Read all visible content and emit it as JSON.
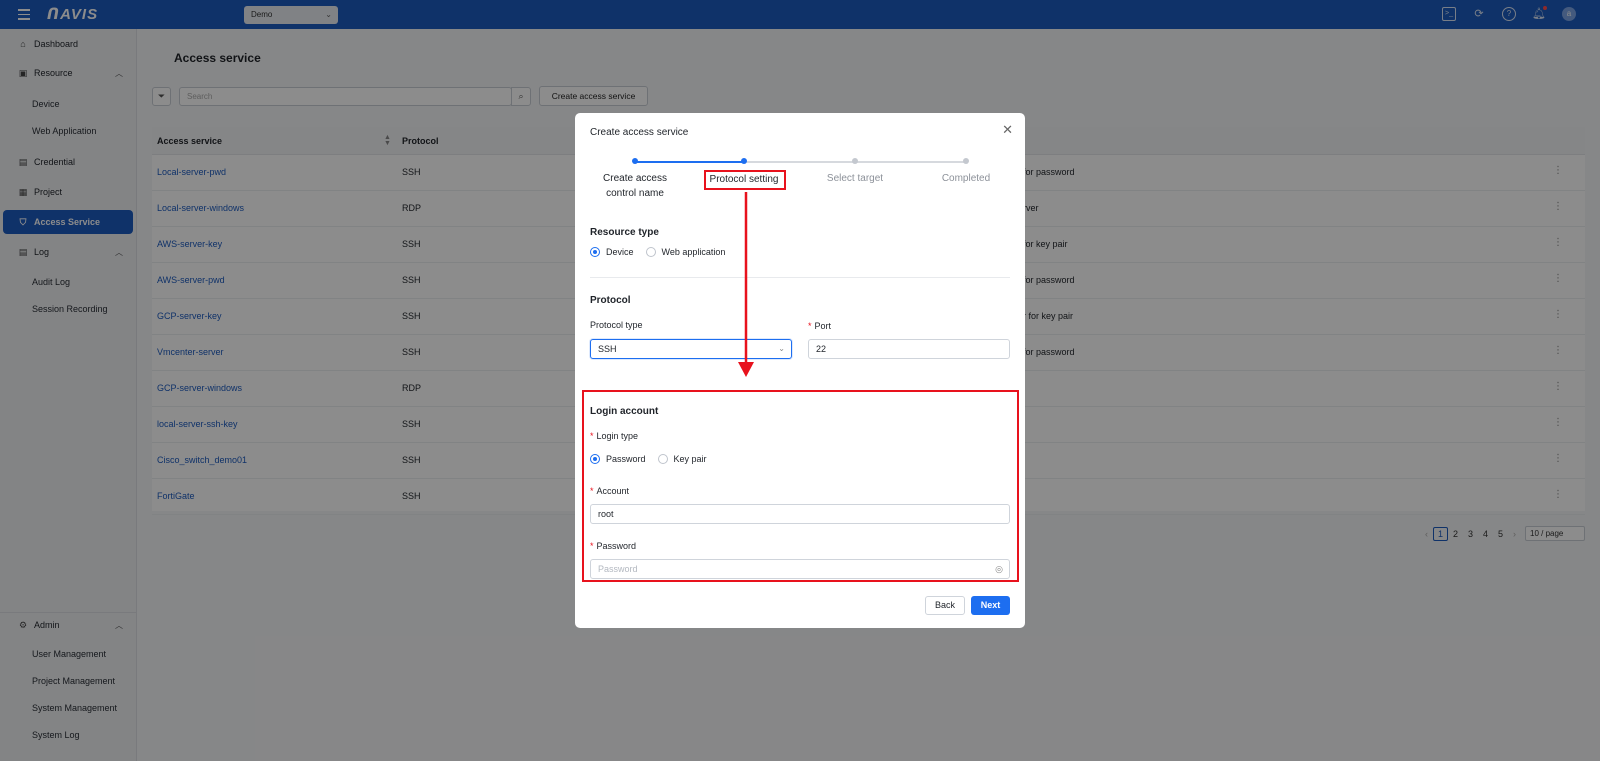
{
  "topbar": {
    "logo": "ᑎAVIS",
    "project": "Demo",
    "avatar_initial": "a"
  },
  "sidebar": {
    "dashboard": "Dashboard",
    "resource": "Resource",
    "device": "Device",
    "web_application": "Web Application",
    "credential": "Credential",
    "project": "Project",
    "access_service": "Access Service",
    "log": "Log",
    "audit_log": "Audit Log",
    "session_recording": "Session Recording",
    "admin": "Admin",
    "user_management": "User Management",
    "project_management": "Project Management",
    "system_management": "System Management",
    "system_log": "System Log"
  },
  "page": {
    "title": "Access service",
    "search_placeholder": "Search",
    "create_button": "Create access service"
  },
  "table": {
    "headers": {
      "name": "Access service",
      "protocol": "Protocol"
    },
    "rows": [
      {
        "name": "Local-server-pwd",
        "protocol": "SSH",
        "desc": "for password"
      },
      {
        "name": "Local-server-windows",
        "protocol": "RDP",
        "desc": "rver"
      },
      {
        "name": "AWS-server-key",
        "protocol": "SSH",
        "desc": "for key pair"
      },
      {
        "name": "AWS-server-pwd",
        "protocol": "SSH",
        "desc": "for password"
      },
      {
        "name": "GCP-server-key",
        "protocol": "SSH",
        "desc": "r for key pair"
      },
      {
        "name": "Vmcenter-server",
        "protocol": "SSH",
        "desc": "for password"
      },
      {
        "name": "GCP-server-windows",
        "protocol": "RDP",
        "desc": ""
      },
      {
        "name": "local-server-ssh-key",
        "protocol": "SSH",
        "desc": ""
      },
      {
        "name": "Cisco_switch_demo01",
        "protocol": "SSH",
        "desc": ""
      },
      {
        "name": "FortiGate",
        "protocol": "SSH",
        "desc": ""
      }
    ]
  },
  "pagination": {
    "pages": [
      "1",
      "2",
      "3",
      "4",
      "5"
    ],
    "current": "1",
    "page_size": "10 / page"
  },
  "modal": {
    "title": "Create access service",
    "steps": {
      "s1_line1": "Create access",
      "s1_line2": "control name",
      "s2": "Protocol setting",
      "s3": "Select target",
      "s4": "Completed"
    },
    "resource_type": {
      "title": "Resource type",
      "device": "Device",
      "web_application": "Web application",
      "selected": "Device"
    },
    "protocol": {
      "title": "Protocol",
      "type_label": "Protocol type",
      "type_value": "SSH",
      "port_label": "Port",
      "port_value": "22"
    },
    "login": {
      "title": "Login account",
      "type_label": "Login type",
      "password_option": "Password",
      "keypair_option": "Key pair",
      "selected": "Password",
      "account_label": "Account",
      "account_value": "root",
      "password_label": "Password",
      "password_placeholder": "Password"
    },
    "back_button": "Back",
    "next_button": "Next"
  },
  "colors": {
    "brand": "#1d5bbf",
    "primary": "#1d6ef0",
    "highlight": "#e8121d"
  }
}
